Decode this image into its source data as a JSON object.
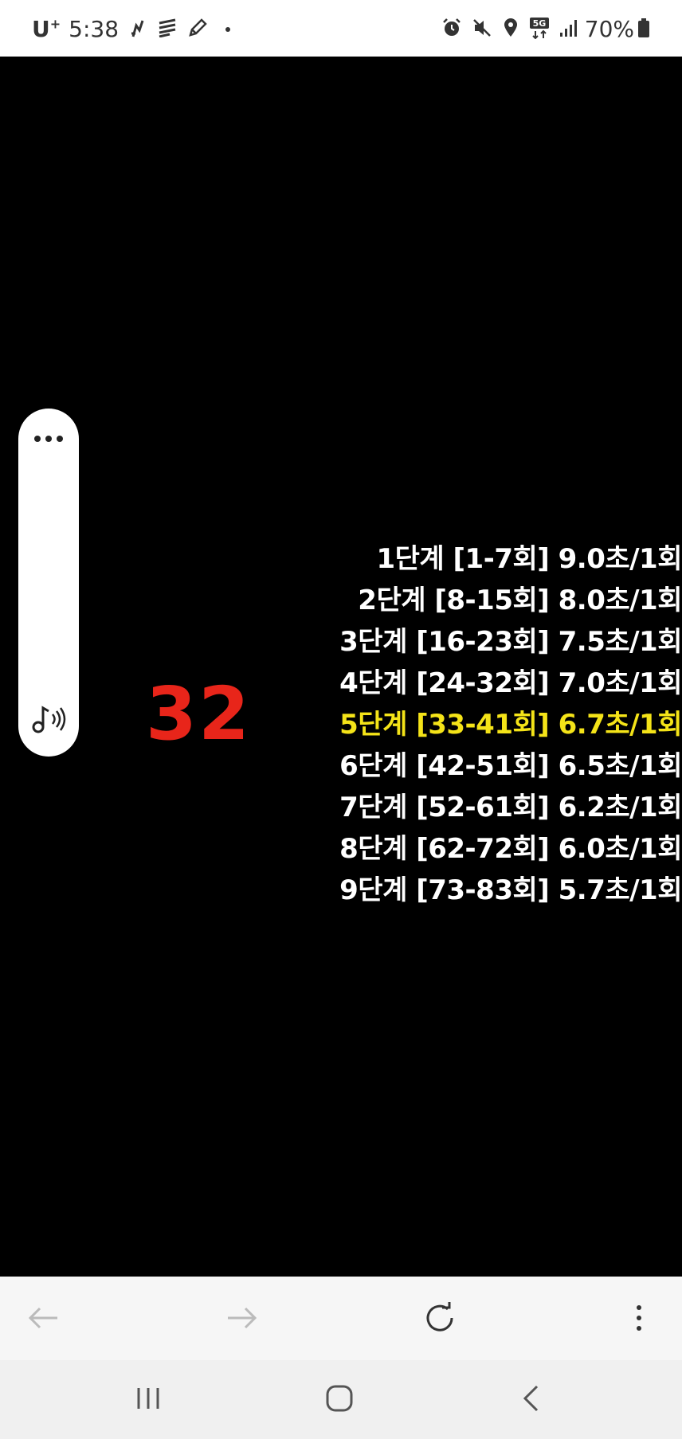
{
  "status_bar": {
    "carrier": "U",
    "carrier_sup": "+",
    "time": "5:38",
    "battery": "70%",
    "network": "5G",
    "icons_left": [
      "strava-icon",
      "layers-icon",
      "pencil-icon"
    ],
    "icons_right": [
      "alarm-icon",
      "mute-icon",
      "location-icon",
      "5g-icon",
      "signal-icon",
      "battery-icon"
    ]
  },
  "video": {
    "counter": "32",
    "active_index": 4,
    "levels": [
      "1단계 [1-7회] 9.0초/1회",
      "2단계 [8-15회] 8.0초/1회",
      "3단계 [16-23회] 7.5초/1회",
      "4단계 [24-32회] 7.0초/1회",
      "5단계 [33-41회] 6.7초/1회",
      "6단계 [42-51회] 6.5초/1회",
      "7단계 [52-61회] 6.2초/1회",
      "8단계 [62-72회] 6.0초/1회",
      "9단계 [73-83회] 5.7초/1회"
    ],
    "colors": {
      "counter": "#e8251a",
      "active": "#f4e318",
      "normal": "#ffffff"
    }
  },
  "side_panel": {
    "icons": [
      "more-dots-icon",
      "music-audio-icon"
    ]
  },
  "browser_toolbar": {
    "icons": [
      "back-arrow-icon",
      "forward-arrow-icon",
      "refresh-icon",
      "more-vert-icon"
    ]
  },
  "nav_bar": {
    "icons": [
      "recent-apps-icon",
      "home-icon",
      "back-chevron-icon"
    ]
  }
}
